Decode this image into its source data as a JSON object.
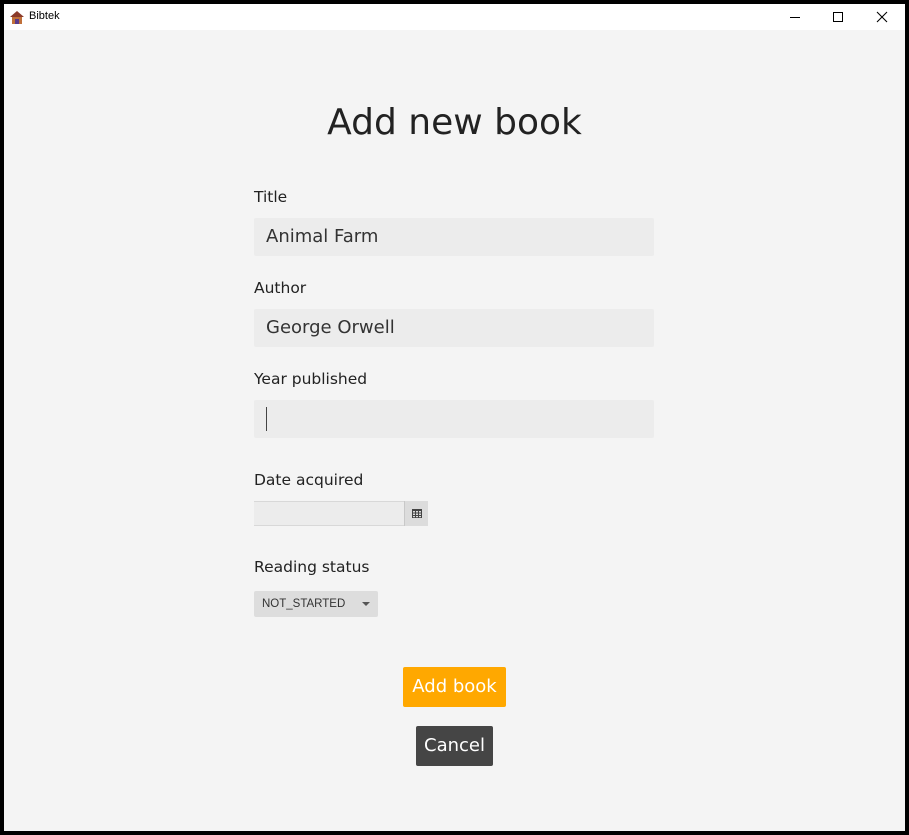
{
  "window": {
    "title": "Bibtek",
    "icon": "house-icon",
    "controls": [
      "minimize-icon",
      "maximize-icon",
      "close-icon"
    ]
  },
  "page": {
    "title": "Add new book"
  },
  "form": {
    "title_label": "Title",
    "title_value": "Animal Farm",
    "author_label": "Author",
    "author_value": "George Orwell",
    "year_label": "Year published",
    "year_value": "",
    "date_label": "Date acquired",
    "date_value": "",
    "date_icon": "calendar-icon",
    "status_label": "Reading status",
    "status_value": "NOT_STARTED"
  },
  "actions": {
    "add_label": "Add book",
    "cancel_label": "Cancel"
  },
  "colors": {
    "accent": "#ffa800",
    "cancel": "#454545",
    "background": "#f4f4f4",
    "input": "#ececec"
  }
}
